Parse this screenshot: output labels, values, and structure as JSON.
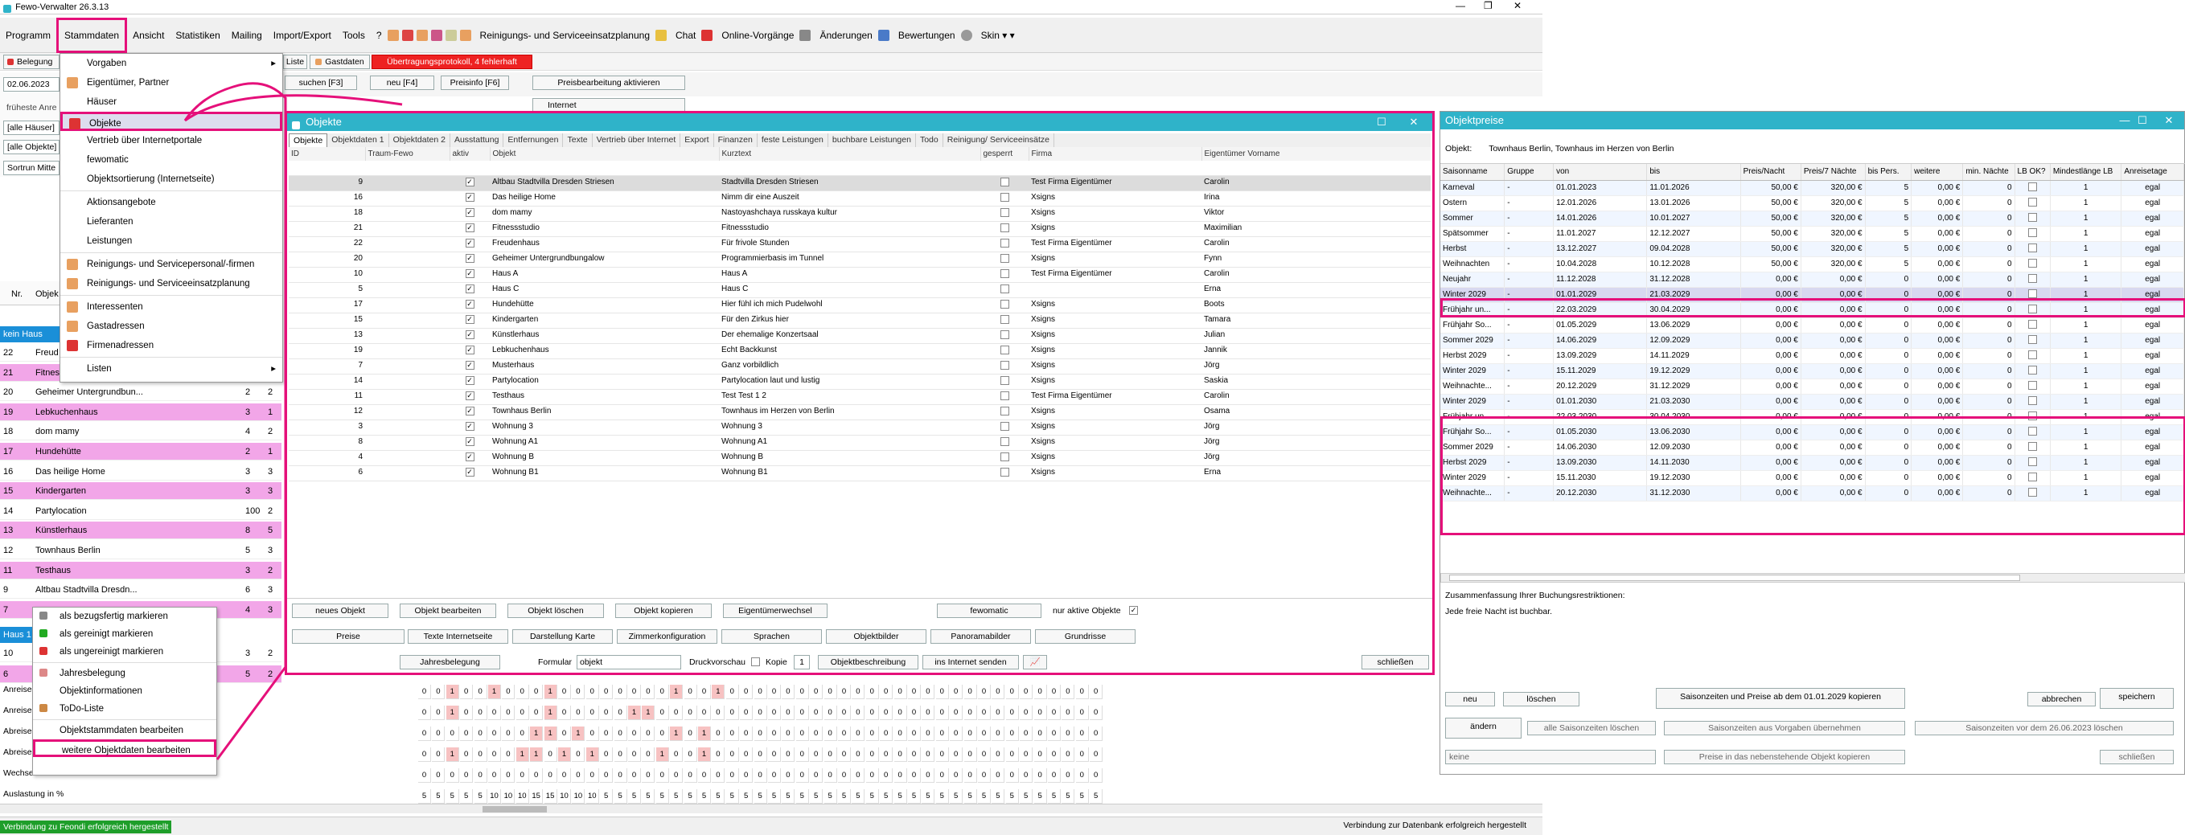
{
  "app": {
    "title": "Fewo-Verwalter 26.3.13"
  },
  "menubar": [
    "Programm",
    "Stammdaten",
    "Ansicht",
    "Statistiken",
    "Mailing",
    "Import/Export",
    "Tools",
    "?",
    "Reinigungs- und Serviceeinsatzplanung",
    "Chat",
    "Online-Vorgänge",
    "Änderungen",
    "Bewertungen",
    "Skin"
  ],
  "toolbar2": {
    "belegung": "Belegung",
    "date": "02.06.2023",
    "hint": "früheste Anre",
    "alle_haeuser": "[alle Häuser]",
    "alle_objekte": "[alle Objekte]",
    "sort": "Sortrun Mitte",
    "liste": "Liste",
    "gastdaten": "Gastdaten",
    "protokoll": "Übertragungsprotokoll, 4 fehlerhaft",
    "suchen": "suchen [F3]",
    "neu": "neu [F4]",
    "preisinfo": "Preisinfo [F6]",
    "preisbearbeitung": "Preisbearbeitung aktivieren",
    "internet": "Internet"
  },
  "dropdown": {
    "items": [
      "Vorgaben",
      "Eigentümer, Partner",
      "Häuser",
      "Objekte",
      "Vertrieb über Internetportale",
      "fewomatic",
      "Objektsortierung (Internetseite)",
      "Aktionsangebote",
      "Lieferanten",
      "Leistungen",
      "Reinigungs- und Servicepersonal/-firmen",
      "Reinigungs- und Serviceeinsatzplanung",
      "Interessenten",
      "Gastadressen",
      "Firmenadressen",
      "Listen"
    ]
  },
  "left": {
    "hdr_nr": "Nr.",
    "hdr_obj": "Objek",
    "kein_haus": "kein Haus",
    "haus1": "Haus 1",
    "rows": [
      {
        "nr": "22",
        "name": "Freud",
        "a": "",
        "b": "",
        "pink": false
      },
      {
        "nr": "21",
        "name": "Fitnessstudio",
        "a": "",
        "b": "",
        "pink": true
      },
      {
        "nr": "20",
        "name": "Geheimer Untergrundbun...",
        "a": "2",
        "b": "2",
        "pink": false
      },
      {
        "nr": "19",
        "name": "Lebkuchenhaus",
        "a": "3",
        "b": "1",
        "pink": true
      },
      {
        "nr": "18",
        "name": "dom mamy",
        "a": "4",
        "b": "2",
        "pink": false
      },
      {
        "nr": "17",
        "name": "Hundehütte",
        "a": "2",
        "b": "1",
        "pink": true
      },
      {
        "nr": "16",
        "name": "Das heilige Home",
        "a": "3",
        "b": "3",
        "pink": false
      },
      {
        "nr": "15",
        "name": "Kindergarten",
        "a": "3",
        "b": "3",
        "pink": true
      },
      {
        "nr": "14",
        "name": "Partylocation",
        "a": "100",
        "b": "2",
        "pink": false
      },
      {
        "nr": "13",
        "name": "Künstlerhaus",
        "a": "8",
        "b": "5",
        "pink": true
      },
      {
        "nr": "12",
        "name": "Townhaus Berlin",
        "a": "5",
        "b": "3",
        "pink": false
      },
      {
        "nr": "11",
        "name": "Testhaus",
        "a": "3",
        "b": "2",
        "pink": true
      },
      {
        "nr": "9",
        "name": "Altbau Stadtvilla Dresdn...",
        "a": "6",
        "b": "3",
        "pink": false
      },
      {
        "nr": "7",
        "name": "",
        "a": "4",
        "b": "3",
        "pink": true
      }
    ],
    "r10": "10",
    "r10a": "3",
    "r10b": "2",
    "r6": "6",
    "r6a": "5",
    "r6b": "2",
    "anreise": "Anreise",
    "abreise": "Abreise",
    "wechsel": "Wechsel",
    "auslastung": "Auslastung in %"
  },
  "ctx": {
    "items": [
      "als bezugsfertig markieren",
      "als gereinigt markieren",
      "als ungereinigt markieren",
      "Jahresbelegung",
      "Objektinformationen",
      "ToDo-Liste",
      "Objektstammdaten bearbeiten",
      "weitere Objektdaten bearbeiten"
    ]
  },
  "objekte": {
    "title": "Objekte",
    "tabs": [
      "Objekte",
      "Objektdaten 1",
      "Objektdaten 2",
      "Ausstattung",
      "Entfernungen",
      "Texte",
      "Vertrieb über Internet",
      "Export",
      "Finanzen",
      "feste Leistungen",
      "buchbare Leistungen",
      "Todo",
      "Reinigung/ Serviceeinsätze"
    ],
    "cols": [
      "ID",
      "Traum-Fewo",
      "aktiv",
      "Objekt",
      "Kurztext",
      "gesperrt",
      "Firma",
      "Eigentümer Vorname"
    ],
    "rows": [
      [
        "9",
        "",
        "✓",
        "Altbau Stadtvilla Dresden Striesen",
        "Stadtvilla Dresden Striesen",
        "",
        "Test Firma Eigentümer",
        "Carolin"
      ],
      [
        "16",
        "",
        "✓",
        "Das heilige Home",
        "Nimm dir eine Auszeit",
        "",
        "Xsigns",
        "Irina"
      ],
      [
        "18",
        "",
        "✓",
        "dom mamy",
        "Nastoyashchaya russkaya kultur",
        "",
        "Xsigns",
        "Viktor"
      ],
      [
        "21",
        "",
        "✓",
        "Fitnessstudio",
        "Fitnessstudio",
        "",
        "Xsigns",
        "Maximilian"
      ],
      [
        "22",
        "",
        "✓",
        "Freudenhaus",
        "Für frivole Stunden",
        "",
        "Test Firma Eigentümer",
        "Carolin"
      ],
      [
        "20",
        "",
        "✓",
        "Geheimer Untergrundbungalow",
        "Programmierbasis im Tunnel",
        "",
        "Xsigns",
        "Fynn"
      ],
      [
        "10",
        "",
        "✓",
        "Haus A",
        "Haus A",
        "",
        "Test Firma Eigentümer",
        "Carolin"
      ],
      [
        "5",
        "",
        "✓",
        "Haus C",
        "Haus C",
        "",
        "",
        "Erna"
      ],
      [
        "17",
        "",
        "✓",
        "Hundehütte",
        "Hier fühl ich mich Pudelwohl",
        "",
        "Xsigns",
        "Boots"
      ],
      [
        "15",
        "",
        "✓",
        "Kindergarten",
        "Für den Zirkus hier",
        "",
        "Xsigns",
        "Tamara"
      ],
      [
        "13",
        "",
        "✓",
        "Künstlerhaus",
        "Der ehemalige Konzertsaal",
        "",
        "Xsigns",
        "Julian"
      ],
      [
        "19",
        "",
        "✓",
        "Lebkuchenhaus",
        "Echt Backkunst",
        "",
        "Xsigns",
        "Jannik"
      ],
      [
        "7",
        "",
        "✓",
        "Musterhaus",
        "Ganz vorbildlich",
        "",
        "Xsigns",
        "Jörg"
      ],
      [
        "14",
        "",
        "✓",
        "Partylocation",
        "Partylocation laut und lustig",
        "",
        "Xsigns",
        "Saskia"
      ],
      [
        "11",
        "",
        "✓",
        "Testhaus",
        "Test Test 1 2",
        "",
        "Test Firma Eigentümer",
        "Carolin"
      ],
      [
        "12",
        "",
        "✓",
        "Townhaus Berlin",
        "Townhaus im Herzen von Berlin",
        "",
        "Xsigns",
        "Osama"
      ],
      [
        "3",
        "",
        "✓",
        "Wohnung 3",
        "Wohnung 3",
        "",
        "Xsigns",
        "Jörg"
      ],
      [
        "8",
        "",
        "✓",
        "Wohnung A1",
        "Wohnung A1",
        "",
        "Xsigns",
        "Jörg"
      ],
      [
        "4",
        "",
        "✓",
        "Wohnung B",
        "Wohnung B",
        "",
        "Xsigns",
        "Jörg"
      ],
      [
        "6",
        "",
        "✓",
        "Wohnung B1",
        "Wohnung B1",
        "",
        "Xsigns",
        "Erna"
      ]
    ],
    "buttons": {
      "neues": "neues Objekt",
      "bearbeiten": "Objekt bearbeiten",
      "loeschen": "Objekt löschen",
      "kopieren": "Objekt kopieren",
      "eigentuemer": "Eigentümerwechsel",
      "fewomatic": "fewomatic",
      "nur_aktive": "nur aktive Objekte",
      "preise": "Preise",
      "texte": "Texte Internetseite",
      "karte": "Darstellung Karte",
      "zimmer": "Zimmerkonfiguration",
      "sprachen": "Sprachen",
      "objektbilder": "Objektbilder",
      "panorama": "Panoramabilder",
      "grundrisse": "Grundrisse",
      "jahresbelegung": "Jahresbelegung",
      "formular": "Formular",
      "formular_val": "objekt",
      "druckvorschau": "Druckvorschau",
      "kopie": "Kopie",
      "kopie_val": "1",
      "beschreibung": "Objektbeschreibung",
      "internet": "ins Internet senden",
      "schliessen": "schließen"
    }
  },
  "preise": {
    "title": "Objektpreise",
    "objekt_label": "Objekt:",
    "objekt_val": "Townhaus Berlin, Townhaus im Herzen von Berlin",
    "cols": [
      "Saisonname",
      "Gruppe",
      "von",
      "bis",
      "Preis/Nacht",
      "Preis/7 Nächte",
      "bis Pers.",
      "weitere",
      "min. Nächte",
      "LB OK?",
      "Mindestlänge LB",
      "Anreisetage"
    ],
    "rows": [
      [
        "Karneval",
        "-",
        "01.01.2023",
        "11.01.2026",
        "50,00 €",
        "320,00 €",
        "5",
        "0,00 €",
        "0",
        "",
        "1",
        "egal"
      ],
      [
        "Ostern",
        "-",
        "12.01.2026",
        "13.01.2026",
        "50,00 €",
        "320,00 €",
        "5",
        "0,00 €",
        "0",
        "",
        "1",
        "egal"
      ],
      [
        "Sommer",
        "-",
        "14.01.2026",
        "10.01.2027",
        "50,00 €",
        "320,00 €",
        "5",
        "0,00 €",
        "0",
        "",
        "1",
        "egal"
      ],
      [
        "Spätsommer",
        "-",
        "11.01.2027",
        "12.12.2027",
        "50,00 €",
        "320,00 €",
        "5",
        "0,00 €",
        "0",
        "",
        "1",
        "egal"
      ],
      [
        "Herbst",
        "-",
        "13.12.2027",
        "09.04.2028",
        "50,00 €",
        "320,00 €",
        "5",
        "0,00 €",
        "0",
        "",
        "1",
        "egal"
      ],
      [
        "Weihnachten",
        "-",
        "10.04.2028",
        "10.12.2028",
        "50,00 €",
        "320,00 €",
        "5",
        "0,00 €",
        "0",
        "",
        "1",
        "egal"
      ],
      [
        "Neujahr",
        "-",
        "11.12.2028",
        "31.12.2028",
        "0,00 €",
        "0,00 €",
        "0",
        "0,00 €",
        "0",
        "",
        "1",
        "egal"
      ],
      [
        "Winter 2029",
        "-",
        "01.01.2029",
        "21.03.2029",
        "0,00 €",
        "0,00 €",
        "0",
        "0,00 €",
        "0",
        "",
        "1",
        "egal"
      ],
      [
        "Frühjahr un...",
        "-",
        "22.03.2029",
        "30.04.2029",
        "0,00 €",
        "0,00 €",
        "0",
        "0,00 €",
        "0",
        "",
        "1",
        "egal"
      ],
      [
        "Frühjahr So...",
        "-",
        "01.05.2029",
        "13.06.2029",
        "0,00 €",
        "0,00 €",
        "0",
        "0,00 €",
        "0",
        "",
        "1",
        "egal"
      ],
      [
        "Sommer 2029",
        "-",
        "14.06.2029",
        "12.09.2029",
        "0,00 €",
        "0,00 €",
        "0",
        "0,00 €",
        "0",
        "",
        "1",
        "egal"
      ],
      [
        "Herbst 2029",
        "-",
        "13.09.2029",
        "14.11.2029",
        "0,00 €",
        "0,00 €",
        "0",
        "0,00 €",
        "0",
        "",
        "1",
        "egal"
      ],
      [
        "Winter 2029",
        "-",
        "15.11.2029",
        "19.12.2029",
        "0,00 €",
        "0,00 €",
        "0",
        "0,00 €",
        "0",
        "",
        "1",
        "egal"
      ],
      [
        "Weihnachte...",
        "-",
        "20.12.2029",
        "31.12.2029",
        "0,00 €",
        "0,00 €",
        "0",
        "0,00 €",
        "0",
        "",
        "1",
        "egal"
      ],
      [
        "Winter 2029",
        "-",
        "01.01.2030",
        "21.03.2030",
        "0,00 €",
        "0,00 €",
        "0",
        "0,00 €",
        "0",
        "",
        "1",
        "egal"
      ],
      [
        "Frühjahr un...",
        "-",
        "22.03.2030",
        "30.04.2030",
        "0,00 €",
        "0,00 €",
        "0",
        "0,00 €",
        "0",
        "",
        "1",
        "egal"
      ],
      [
        "Frühjahr So...",
        "-",
        "01.05.2030",
        "13.06.2030",
        "0,00 €",
        "0,00 €",
        "0",
        "0,00 €",
        "0",
        "",
        "1",
        "egal"
      ],
      [
        "Sommer 2029",
        "-",
        "14.06.2030",
        "12.09.2030",
        "0,00 €",
        "0,00 €",
        "0",
        "0,00 €",
        "0",
        "",
        "1",
        "egal"
      ],
      [
        "Herbst 2029",
        "-",
        "13.09.2030",
        "14.11.2030",
        "0,00 €",
        "0,00 €",
        "0",
        "0,00 €",
        "0",
        "",
        "1",
        "egal"
      ],
      [
        "Winter 2029",
        "-",
        "15.11.2030",
        "19.12.2030",
        "0,00 €",
        "0,00 €",
        "0",
        "0,00 €",
        "0",
        "",
        "1",
        "egal"
      ],
      [
        "Weihnachte...",
        "-",
        "20.12.2030",
        "31.12.2030",
        "0,00 €",
        "0,00 €",
        "0",
        "0,00 €",
        "0",
        "",
        "1",
        "egal"
      ]
    ],
    "summary1": "Zusammenfassung Ihrer Buchungsrestriktionen:",
    "summary2": "Jede freie Nacht ist buchbar.",
    "btn": {
      "neu": "neu",
      "loeschen": "löschen",
      "kopieren": "Saisonzeiten und Preise ab dem 01.01.2029 kopieren",
      "abbrechen": "abbrechen",
      "speichern": "speichern",
      "aendern": "ändern",
      "alle_loeschen": "alle Saisonzeiten löschen",
      "vorgaben": "Saisonzeiten aus Vorgaben übernehmen",
      "vor_loeschen": "Saisonzeiten vor dem 26.06.2023 löschen",
      "keine": "keine",
      "nebenstehend": "Preise in das nebenstehende Objekt kopieren",
      "schliessen": "schließen"
    }
  },
  "status": {
    "left": "Verbindung zu Feondi erfolgreich hergestellt",
    "right": "Verbindung zur Datenbank erfolgreich hergestellt"
  },
  "heat": {
    "anreise1": [
      0,
      0,
      1,
      0,
      0,
      1,
      0,
      0,
      0,
      1,
      0,
      0,
      0,
      0,
      0,
      0,
      0,
      0,
      1,
      0,
      0,
      1,
      0,
      0,
      0,
      0,
      0,
      0,
      0,
      0,
      0,
      0,
      0,
      0,
      0,
      0,
      0,
      0,
      0,
      0,
      0,
      0,
      0,
      0,
      0,
      0,
      0,
      0,
      0
    ],
    "anreise2": [
      0,
      0,
      1,
      0,
      0,
      0,
      0,
      0,
      0,
      1,
      0,
      0,
      0,
      0,
      0,
      1,
      1,
      0,
      0,
      0,
      0,
      0,
      0,
      0,
      0,
      0,
      0,
      0,
      0,
      0,
      0,
      0,
      0,
      0,
      0,
      0,
      0,
      0,
      0,
      0,
      0,
      0,
      0,
      0,
      0,
      0,
      0,
      0,
      0
    ],
    "abreise1": [
      0,
      0,
      0,
      0,
      0,
      0,
      0,
      0,
      1,
      1,
      0,
      1,
      0,
      0,
      0,
      0,
      0,
      0,
      1,
      0,
      1,
      0,
      0,
      0,
      0,
      0,
      0,
      0,
      0,
      0,
      0,
      0,
      0,
      0,
      0,
      0,
      0,
      0,
      0,
      0,
      0,
      0,
      0,
      0,
      0,
      0,
      0,
      0,
      0
    ],
    "abreise2": [
      0,
      0,
      1,
      0,
      0,
      0,
      0,
      1,
      1,
      0,
      1,
      0,
      1,
      0,
      0,
      0,
      0,
      1,
      0,
      0,
      1,
      0,
      0,
      0,
      0,
      0,
      0,
      0,
      0,
      0,
      0,
      0,
      0,
      0,
      0,
      0,
      0,
      0,
      0,
      0,
      0,
      0,
      0,
      0,
      0,
      0,
      0,
      0,
      0
    ],
    "wechsel": [
      0,
      0,
      0,
      0,
      0,
      0,
      0,
      0,
      0,
      0,
      0,
      0,
      0,
      0,
      0,
      0,
      0,
      0,
      0,
      0,
      0,
      0,
      0,
      0,
      0,
      0,
      0,
      0,
      0,
      0,
      0,
      0,
      0,
      0,
      0,
      0,
      0,
      0,
      0,
      0,
      0,
      0,
      0,
      0,
      0,
      0,
      0,
      0,
      0
    ],
    "ausl": [
      5,
      5,
      5,
      5,
      5,
      10,
      10,
      10,
      15,
      15,
      10,
      10,
      10,
      5,
      5,
      5,
      5,
      5,
      5,
      5,
      5,
      5,
      5,
      5,
      5,
      5,
      5,
      5,
      5,
      5,
      5,
      5,
      5,
      5,
      5,
      5,
      5,
      5,
      5,
      5,
      5,
      5,
      5,
      5,
      5,
      5,
      5,
      5,
      5
    ]
  }
}
